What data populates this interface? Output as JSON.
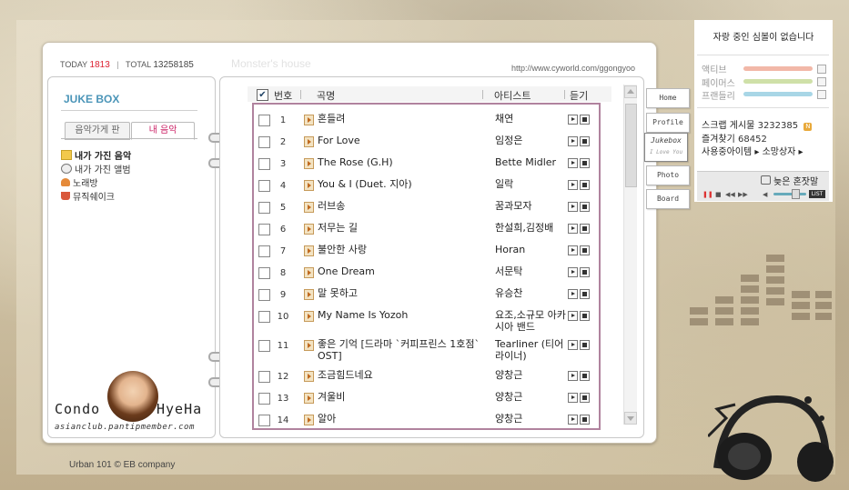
{
  "topbar": {
    "today_label": "TODAY",
    "today_count": "1813",
    "total_label": "TOTAL",
    "total_count": "13258185",
    "home_title": "Monster's house",
    "url": "http://www.cyworld.com/ggongyoo"
  },
  "left": {
    "title": "JUKE BOX",
    "tabs": [
      "음악가게 판",
      "내 음악"
    ],
    "menu": [
      {
        "label": "내가 가진 음악",
        "icon": "folder-icon"
      },
      {
        "label": "내가 가진 앨범",
        "icon": "album-icon"
      },
      {
        "label": "노래방",
        "icon": "microphone-icon"
      },
      {
        "label": "뮤직쉐이크",
        "icon": "cup-icon"
      }
    ],
    "signature_left": "Condo",
    "signature_right": "HyeHa",
    "club": "asianclub.pantipmember.com"
  },
  "list": {
    "headers": {
      "number": "번호",
      "title": "곡명",
      "artist": "아티스트",
      "listen": "듣기"
    },
    "rows": [
      {
        "num": "1",
        "title": "혼들려",
        "artist": "채연"
      },
      {
        "num": "2",
        "title": "For Love",
        "artist": "임정은"
      },
      {
        "num": "3",
        "title": "The Rose (G.H)",
        "artist": "Bette Midler"
      },
      {
        "num": "4",
        "title": "You & I (Duet. 지아)",
        "artist": "일락"
      },
      {
        "num": "5",
        "title": "러브송",
        "artist": "꿈과모자"
      },
      {
        "num": "6",
        "title": "저무는 길",
        "artist": "한설희,김정배"
      },
      {
        "num": "7",
        "title": "불안한 사랑",
        "artist": "Horan"
      },
      {
        "num": "8",
        "title": "One Dream",
        "artist": "서문탁"
      },
      {
        "num": "9",
        "title": "말 못하고",
        "artist": "유승찬"
      },
      {
        "num": "10",
        "title": "My Name Is Yozoh",
        "artist": "요조,소규모 아카시아 밴드"
      },
      {
        "num": "11",
        "title": "좋은 기억 [드라마 `커피프린스 1호점` OST]",
        "artist": "Tearliner (티어라이너)"
      },
      {
        "num": "12",
        "title": "조금힘드네요",
        "artist": "양창근"
      },
      {
        "num": "13",
        "title": "겨울비",
        "artist": "양창근"
      },
      {
        "num": "14",
        "title": "알아",
        "artist": "양창근"
      }
    ]
  },
  "nav": {
    "tabs": [
      "Home",
      "Profile",
      "Jukebox",
      "Photo",
      "Board"
    ],
    "jukebox_sub": "I Love You"
  },
  "mini": {
    "heading": "자랑 중인 심볼이 없습니다",
    "stats": [
      {
        "label": "액티브",
        "color": "#f2b8a8"
      },
      {
        "label": "페이머스",
        "color": "#cfe0a8"
      },
      {
        "label": "프랜들리",
        "color": "#a8d6e6"
      }
    ],
    "scrap_label": "스크랩 게시물",
    "scrap_count": "3232385",
    "favorite_label": "즐겨찾기",
    "favorite_count": "68452",
    "items_text": "사용중아이템 ▸ 소망상자 ▸",
    "player_song": "늦은 혼잣말",
    "list_label": "LIST"
  },
  "footer": "Urban 101 © EB company"
}
